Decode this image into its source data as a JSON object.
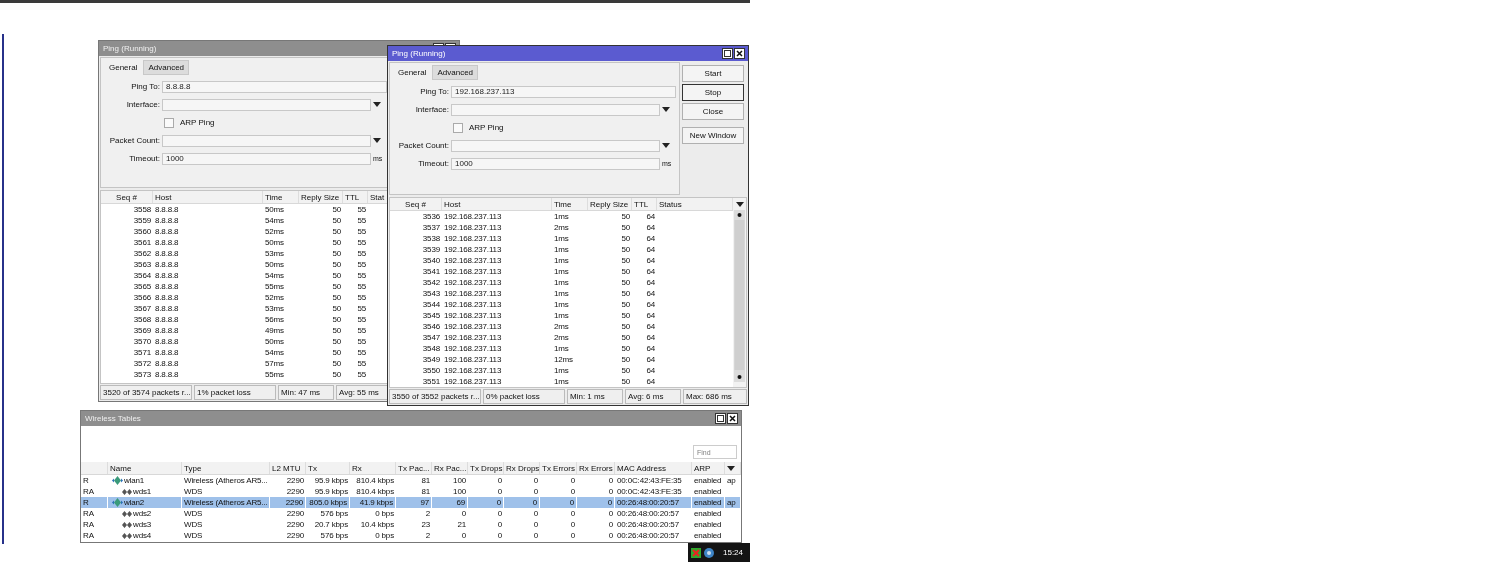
{
  "ping_windows": [
    {
      "title": "Ping (Running)",
      "active": false,
      "tabs": [
        {
          "label": "General",
          "selected": true
        },
        {
          "label": "Advanced",
          "selected": false
        }
      ],
      "fields": [
        {
          "kind": "text",
          "label": "Ping To:",
          "value": "8.8.8.8"
        },
        {
          "kind": "dropdown",
          "label": "Interface:"
        },
        {
          "kind": "checkbox",
          "label": "ARP Ping",
          "checked": false
        },
        {
          "kind": "dropdown",
          "label": "Packet Count:"
        },
        {
          "kind": "text",
          "label": "Timeout:",
          "value": "1000",
          "unit": "ms"
        }
      ],
      "columns": [
        "Seq #",
        "Host",
        "Time",
        "Reply Size",
        "TTL",
        "Stat"
      ],
      "rows": [
        {
          "seq": "3558",
          "host": "8.8.8.8",
          "time": "50ms",
          "reply_size": "50",
          "ttl": "55"
        },
        {
          "seq": "3559",
          "host": "8.8.8.8",
          "time": "54ms",
          "reply_size": "50",
          "ttl": "55"
        },
        {
          "seq": "3560",
          "host": "8.8.8.8",
          "time": "52ms",
          "reply_size": "50",
          "ttl": "55"
        },
        {
          "seq": "3561",
          "host": "8.8.8.8",
          "time": "50ms",
          "reply_size": "50",
          "ttl": "55"
        },
        {
          "seq": "3562",
          "host": "8.8.8.8",
          "time": "53ms",
          "reply_size": "50",
          "ttl": "55"
        },
        {
          "seq": "3563",
          "host": "8.8.8.8",
          "time": "50ms",
          "reply_size": "50",
          "ttl": "55"
        },
        {
          "seq": "3564",
          "host": "8.8.8.8",
          "time": "54ms",
          "reply_size": "50",
          "ttl": "55"
        },
        {
          "seq": "3565",
          "host": "8.8.8.8",
          "time": "55ms",
          "reply_size": "50",
          "ttl": "55"
        },
        {
          "seq": "3566",
          "host": "8.8.8.8",
          "time": "52ms",
          "reply_size": "50",
          "ttl": "55"
        },
        {
          "seq": "3567",
          "host": "8.8.8.8",
          "time": "53ms",
          "reply_size": "50",
          "ttl": "55"
        },
        {
          "seq": "3568",
          "host": "8.8.8.8",
          "time": "56ms",
          "reply_size": "50",
          "ttl": "55"
        },
        {
          "seq": "3569",
          "host": "8.8.8.8",
          "time": "49ms",
          "reply_size": "50",
          "ttl": "55"
        },
        {
          "seq": "3570",
          "host": "8.8.8.8",
          "time": "50ms",
          "reply_size": "50",
          "ttl": "55"
        },
        {
          "seq": "3571",
          "host": "8.8.8.8",
          "time": "54ms",
          "reply_size": "50",
          "ttl": "55"
        },
        {
          "seq": "3572",
          "host": "8.8.8.8",
          "time": "57ms",
          "reply_size": "50",
          "ttl": "55"
        },
        {
          "seq": "3573",
          "host": "8.8.8.8",
          "time": "55ms",
          "reply_size": "50",
          "ttl": "55"
        }
      ],
      "status": [
        "3520 of 3574 packets r...",
        "1% packet loss",
        "Min: 47 ms",
        "Avg: 55 ms"
      ]
    },
    {
      "title": "Ping (Running)",
      "active": true,
      "tabs": [
        {
          "label": "General",
          "selected": true
        },
        {
          "label": "Advanced",
          "selected": false
        }
      ],
      "fields": [
        {
          "kind": "text",
          "label": "Ping To:",
          "value": "192.168.237.113"
        },
        {
          "kind": "dropdown",
          "label": "Interface:"
        },
        {
          "kind": "checkbox",
          "label": "ARP Ping",
          "checked": false
        },
        {
          "kind": "dropdown",
          "label": "Packet Count:"
        },
        {
          "kind": "text",
          "label": "Timeout:",
          "value": "1000",
          "unit": "ms"
        }
      ],
      "buttons": [
        {
          "label": "Start",
          "focused": false
        },
        {
          "label": "Stop",
          "focused": true
        },
        {
          "label": "Close",
          "focused": false
        },
        {
          "label": "New Window",
          "focused": false
        }
      ],
      "columns": [
        "Seq #",
        "Host",
        "Time",
        "Reply Size",
        "TTL",
        "Status"
      ],
      "rows": [
        {
          "seq": "3536",
          "host": "192.168.237.113",
          "time": "1ms",
          "reply_size": "50",
          "ttl": "64"
        },
        {
          "seq": "3537",
          "host": "192.168.237.113",
          "time": "2ms",
          "reply_size": "50",
          "ttl": "64"
        },
        {
          "seq": "3538",
          "host": "192.168.237.113",
          "time": "1ms",
          "reply_size": "50",
          "ttl": "64"
        },
        {
          "seq": "3539",
          "host": "192.168.237.113",
          "time": "1ms",
          "reply_size": "50",
          "ttl": "64"
        },
        {
          "seq": "3540",
          "host": "192.168.237.113",
          "time": "1ms",
          "reply_size": "50",
          "ttl": "64"
        },
        {
          "seq": "3541",
          "host": "192.168.237.113",
          "time": "1ms",
          "reply_size": "50",
          "ttl": "64"
        },
        {
          "seq": "3542",
          "host": "192.168.237.113",
          "time": "1ms",
          "reply_size": "50",
          "ttl": "64"
        },
        {
          "seq": "3543",
          "host": "192.168.237.113",
          "time": "1ms",
          "reply_size": "50",
          "ttl": "64"
        },
        {
          "seq": "3544",
          "host": "192.168.237.113",
          "time": "1ms",
          "reply_size": "50",
          "ttl": "64"
        },
        {
          "seq": "3545",
          "host": "192.168.237.113",
          "time": "1ms",
          "reply_size": "50",
          "ttl": "64"
        },
        {
          "seq": "3546",
          "host": "192.168.237.113",
          "time": "2ms",
          "reply_size": "50",
          "ttl": "64"
        },
        {
          "seq": "3547",
          "host": "192.168.237.113",
          "time": "2ms",
          "reply_size": "50",
          "ttl": "64"
        },
        {
          "seq": "3548",
          "host": "192.168.237.113",
          "time": "1ms",
          "reply_size": "50",
          "ttl": "64"
        },
        {
          "seq": "3549",
          "host": "192.168.237.113",
          "time": "12ms",
          "reply_size": "50",
          "ttl": "64"
        },
        {
          "seq": "3550",
          "host": "192.168.237.113",
          "time": "1ms",
          "reply_size": "50",
          "ttl": "64"
        },
        {
          "seq": "3551",
          "host": "192.168.237.113",
          "time": "1ms",
          "reply_size": "50",
          "ttl": "64"
        }
      ],
      "status": [
        "3550 of 3552 packets r...",
        "0% packet loss",
        "Min: 1 ms",
        "Avg: 6 ms",
        "Max: 686 ms"
      ]
    }
  ],
  "wireless_window": {
    "title": "Wireless Tables",
    "active": false,
    "find": {
      "placeholder": "Find"
    },
    "columns": [
      "Name",
      "Type",
      "L2 MTU",
      "Tx",
      "Rx",
      "Tx Pac...",
      "Rx Pac...",
      "Tx Drops",
      "Rx Drops",
      "Tx Errors",
      "Rx Errors",
      "MAC Address",
      "ARP"
    ],
    "rows": [
      {
        "column_1": "R",
        "name": "wlan1",
        "kind": "wireless",
        "type": "Wireless (Atheros AR5...",
        "l2_mtu": "2290",
        "tx": "95.9 kbps",
        "rx": "810.4 kbps",
        "tx_packets": "81",
        "rx_packets": "100",
        "tx_drops": "0",
        "rx_drops": "0",
        "tx_errors": "0",
        "rx_errors": "0",
        "mac_address": "00:0C:42:43:FE:35",
        "arp": "enabled",
        "column_15": "ap",
        "selected": false,
        "children": [
          {
            "column_1": "RA",
            "name": "wds1",
            "kind": "wds",
            "type": "WDS",
            "l2_mtu": "2290",
            "tx": "95.9 kbps",
            "rx": "810.4 kbps",
            "tx_packets": "81",
            "rx_packets": "100",
            "tx_drops": "0",
            "rx_drops": "0",
            "tx_errors": "0",
            "rx_errors": "0",
            "mac_address": "00:0C:42:43:FE:35",
            "arp": "enabled",
            "selected": false
          }
        ]
      },
      {
        "column_1": "R",
        "name": "wlan2",
        "kind": "wireless",
        "type": "Wireless (Atheros AR5...",
        "l2_mtu": "2290",
        "tx": "805.0 kbps",
        "rx": "41.9 kbps",
        "tx_packets": "97",
        "rx_packets": "69",
        "tx_drops": "0",
        "rx_drops": "0",
        "tx_errors": "0",
        "rx_errors": "0",
        "mac_address": "00:26:48:00:20:57",
        "arp": "enabled",
        "column_15": "ap",
        "selected": true,
        "children": [
          {
            "column_1": "RA",
            "name": "wds2",
            "kind": "wds",
            "type": "WDS",
            "l2_mtu": "2290",
            "tx": "576 bps",
            "rx": "0 bps",
            "tx_packets": "2",
            "rx_packets": "0",
            "tx_drops": "0",
            "rx_drops": "0",
            "tx_errors": "0",
            "rx_errors": "0",
            "mac_address": "00:26:48:00:20:57",
            "arp": "enabled",
            "selected": false
          },
          {
            "column_1": "RA",
            "name": "wds3",
            "kind": "wds",
            "type": "WDS",
            "l2_mtu": "2290",
            "tx": "20.7 kbps",
            "rx": "10.4 kbps",
            "tx_packets": "23",
            "rx_packets": "21",
            "tx_drops": "0",
            "rx_drops": "0",
            "tx_errors": "0",
            "rx_errors": "0",
            "mac_address": "00:26:48:00:20:57",
            "arp": "enabled",
            "selected": false
          },
          {
            "column_1": "RA",
            "name": "wds4",
            "kind": "wds",
            "type": "WDS",
            "l2_mtu": "2290",
            "tx": "576 bps",
            "rx": "0 bps",
            "tx_packets": "2",
            "rx_packets": "0",
            "tx_drops": "0",
            "rx_drops": "0",
            "tx_errors": "0",
            "rx_errors": "0",
            "mac_address": "00:26:48:00:20:57",
            "arp": "enabled",
            "selected": false
          }
        ]
      }
    ]
  },
  "tray": {
    "clock": "15:24"
  }
}
